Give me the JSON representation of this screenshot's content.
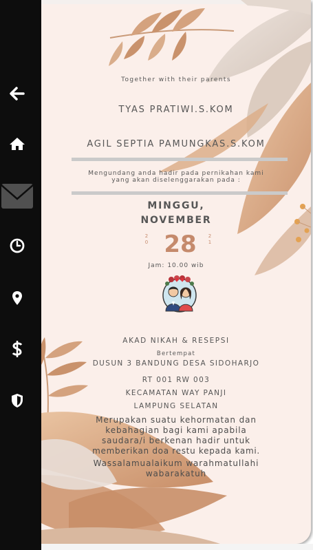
{
  "sidebar": {
    "items": [
      {
        "icon": "arrow-left-icon"
      },
      {
        "icon": "home-icon"
      },
      {
        "icon": "envelope-icon"
      },
      {
        "icon": "clock-icon"
      },
      {
        "icon": "map-pin-icon"
      },
      {
        "icon": "dollar-icon"
      },
      {
        "icon": "shield-icon"
      }
    ]
  },
  "invitation": {
    "intro": "Together with their parents",
    "groom": "TYAS PRATIWI.S.KOM",
    "bride": "AGIL SEPTIA PAMUNGKAS.S.KOM",
    "invite_line1": "Mengundang anda hadir pada pernikahan kami",
    "invite_line2": "yang akan diselenggarakan pada :",
    "day": "MINGGU,",
    "month": "NOVEMBER",
    "date": "28",
    "year_left_1": "2",
    "year_left_2": "0",
    "year_right_1": "2",
    "year_right_2": "1",
    "time": "Jam: 10.00 wib",
    "event": "AKAD NIKAH & RESEPSI",
    "venue_label": "Bertempat",
    "address_1": "DUSUN 3 BANDUNG DESA SIDOHARJO",
    "address_2": "RT 001 RW 003",
    "address_3": "KECAMATAN WAY PANJI",
    "address_4": "LAMPUNG SELATAN",
    "closing_1": "Merupakan suatu kehormatan dan",
    "closing_2": "kebahagian bagi kami apabila",
    "closing_3": "saudara/i berkenan hadir untuk",
    "closing_4": "memberikan doa restu kepada kami.",
    "closing_5": "Wassalamualaikum warahmatullahi",
    "closing_6": "wabarakatuh"
  },
  "colors": {
    "sidebar_bg": "#0d0d0d",
    "card_bg": "#fbefea",
    "accent": "#c58a6c",
    "text": "#565656",
    "separator": "#cacaca"
  }
}
